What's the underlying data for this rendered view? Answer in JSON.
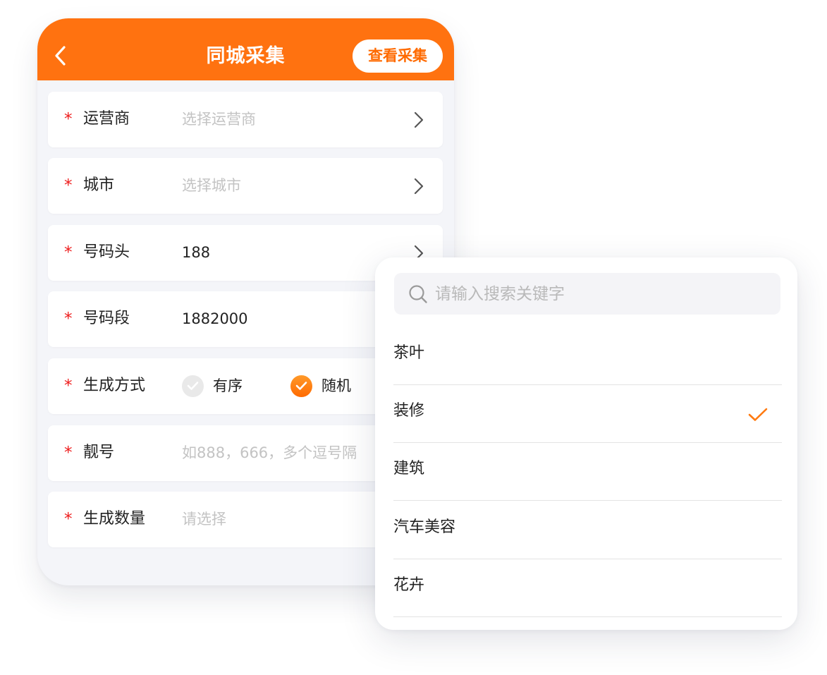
{
  "header": {
    "title": "同城采集",
    "view_button": "查看采集"
  },
  "colors": {
    "brand": "#ff7210",
    "required": "#ee1c1c"
  },
  "form": {
    "required_mark": "*",
    "rows": [
      {
        "label": "运营商",
        "placeholder": "选择运营商"
      },
      {
        "label": "城市",
        "placeholder": "选择城市"
      },
      {
        "label": "号码头",
        "value": "188"
      },
      {
        "label": "号码段",
        "value": "1882000"
      },
      {
        "label": "生成方式",
        "options": [
          {
            "label": "有序",
            "selected": false
          },
          {
            "label": "随机",
            "selected": true
          }
        ]
      },
      {
        "label": "靓号",
        "placeholder": "如888，666，多个逗号隔"
      },
      {
        "label": "生成数量",
        "placeholder": "请选择"
      }
    ]
  },
  "dropdown": {
    "search_placeholder": "请输入搜索关键字",
    "options": [
      {
        "label": "茶叶",
        "selected": false
      },
      {
        "label": "装修",
        "selected": true
      },
      {
        "label": "建筑",
        "selected": false
      },
      {
        "label": "汽车美容",
        "selected": false
      },
      {
        "label": "花卉",
        "selected": false
      }
    ]
  },
  "icons": [
    "back-arrow-icon",
    "chevron-right-icon",
    "search-icon",
    "check-icon"
  ]
}
